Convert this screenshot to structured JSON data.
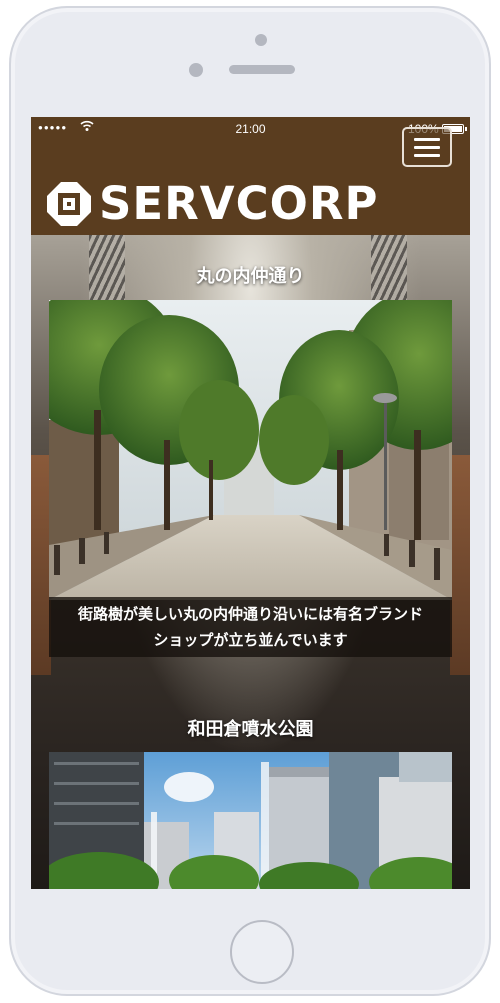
{
  "status_bar": {
    "signal": "●●●●●",
    "time": "21:00",
    "battery": "100%"
  },
  "header": {
    "brand": "SERVCORP",
    "menu_icon": "hamburger-icon",
    "logo_icon": "servcorp-logo-icon"
  },
  "sections": [
    {
      "title": "丸の内仲通り",
      "caption": "街路樹が美しい丸の内仲通り沿いには有名ブランドショップが立ち並んでいます",
      "caption_line1": "街路樹が美しい丸の内仲通り沿いには有名ブランド",
      "caption_line2": "ショップが立ち並んでいます"
    },
    {
      "title": "和田倉噴水公園"
    }
  ],
  "colors": {
    "brand_brown": "#5a3d1f",
    "phone_frame": "#e9ebf1"
  }
}
